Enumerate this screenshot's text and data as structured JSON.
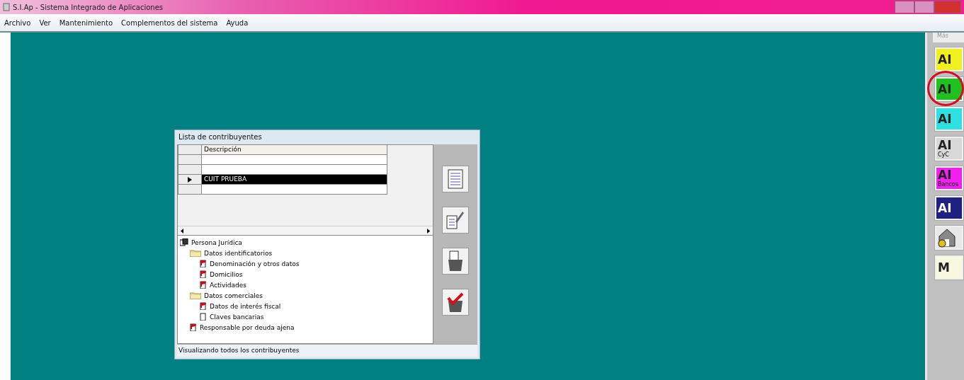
{
  "window": {
    "title": "S.I.Ap - Sistema Integrado de Aplicaciones"
  },
  "menu": [
    "Archivo",
    "Ver",
    "Mantenimiento",
    "Complementos del sistema",
    "Ayuda"
  ],
  "dialog": {
    "title": "Lista de contribuyentes",
    "table": {
      "columns": [
        "Descripción"
      ],
      "rows": [
        {
          "selected": false
        },
        {
          "selected": false
        },
        {
          "selected": true,
          "cells": [
            "CUIT PRUEBA"
          ]
        },
        {
          "selected": false
        }
      ]
    },
    "tree": [
      {
        "label": "Persona Jurídica",
        "kind": "root",
        "children": [
          {
            "label": "Datos identificatorios",
            "kind": "folder",
            "children": [
              {
                "label": "Denominación y otros datos",
                "kind": "marked"
              },
              {
                "label": "Domicilios",
                "kind": "marked"
              },
              {
                "label": "Actividades",
                "kind": "marked"
              }
            ]
          },
          {
            "label": "Datos comerciales",
            "kind": "folder",
            "children": [
              {
                "label": "Datos de interés fiscal",
                "kind": "marked"
              },
              {
                "label": "Claves bancarias",
                "kind": "blank"
              }
            ]
          },
          {
            "label": "Responsable por deuda ajena",
            "kind": "marked"
          }
        ]
      }
    ],
    "status": "Visualizando todos los contribuyentes"
  },
  "side_panel": {
    "header": "Más",
    "items": [
      {
        "big": "AI",
        "color": "#f0f020",
        "highlighted": false
      },
      {
        "big": "AI",
        "color": "#20c020",
        "highlighted": true
      },
      {
        "big": "AI",
        "color": "#30e0e0",
        "highlighted": false
      },
      {
        "big": "AI",
        "caption": "CyC",
        "color": "#d8d8d8",
        "highlighted": false
      },
      {
        "big": "AI",
        "caption": "Bancos",
        "color": "#f020f0",
        "highlighted": false
      },
      {
        "big": "AI",
        "color": "#202080",
        "highlighted": false
      },
      {
        "kind": "house",
        "color": "#e8e8e8",
        "highlighted": false
      },
      {
        "big": "M",
        "color": "#f8f8e0",
        "highlighted": false
      }
    ]
  }
}
